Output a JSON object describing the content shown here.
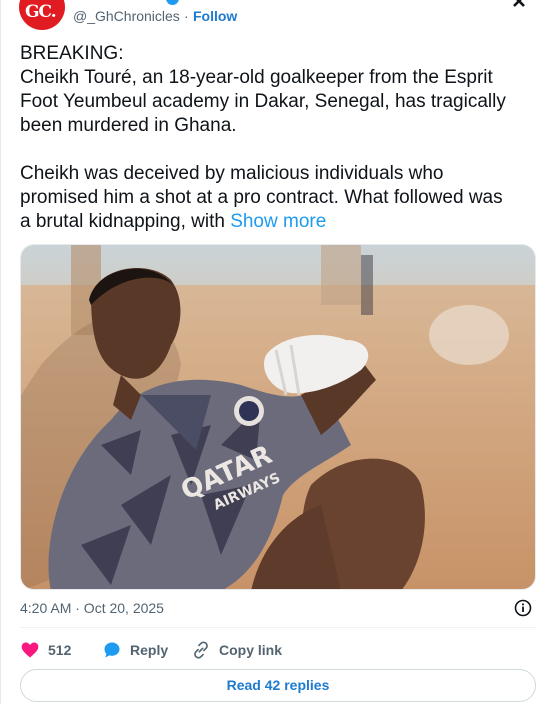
{
  "header": {
    "avatar_text": "GC.",
    "handle": "@_GhChronicles",
    "separator": "·",
    "follow_label": "Follow"
  },
  "tweet": {
    "lines": [
      "BREAKING:",
      "Cheikh Touré, an 18-year-old goalkeeper from the Esprit",
      "Foot Yeumbeul academy in Dakar, Senegal, has tragically",
      "been murdered in Ghana."
    ],
    "lines2": [
      "Cheikh was deceived by malicious individuals who",
      "promised him a shot at a pro contract. What followed was"
    ],
    "last_line": "a brutal kidnapping, with ",
    "show_more": "Show more"
  },
  "photo": {
    "jersey_text_1": "QATAR",
    "jersey_text_2": "AIRWAYS"
  },
  "meta": {
    "timestamp": "4:20 AM · Oct 20, 2025"
  },
  "actions": {
    "likes_count": "512",
    "reply_label": "Reply",
    "copy_label": "Copy link"
  },
  "footer": {
    "read_replies": "Read 42 replies"
  },
  "colors": {
    "accent": "#1d9bf0",
    "link": "#1d7bd0",
    "heart": "#f91880",
    "brand_red": "#e11b22"
  }
}
